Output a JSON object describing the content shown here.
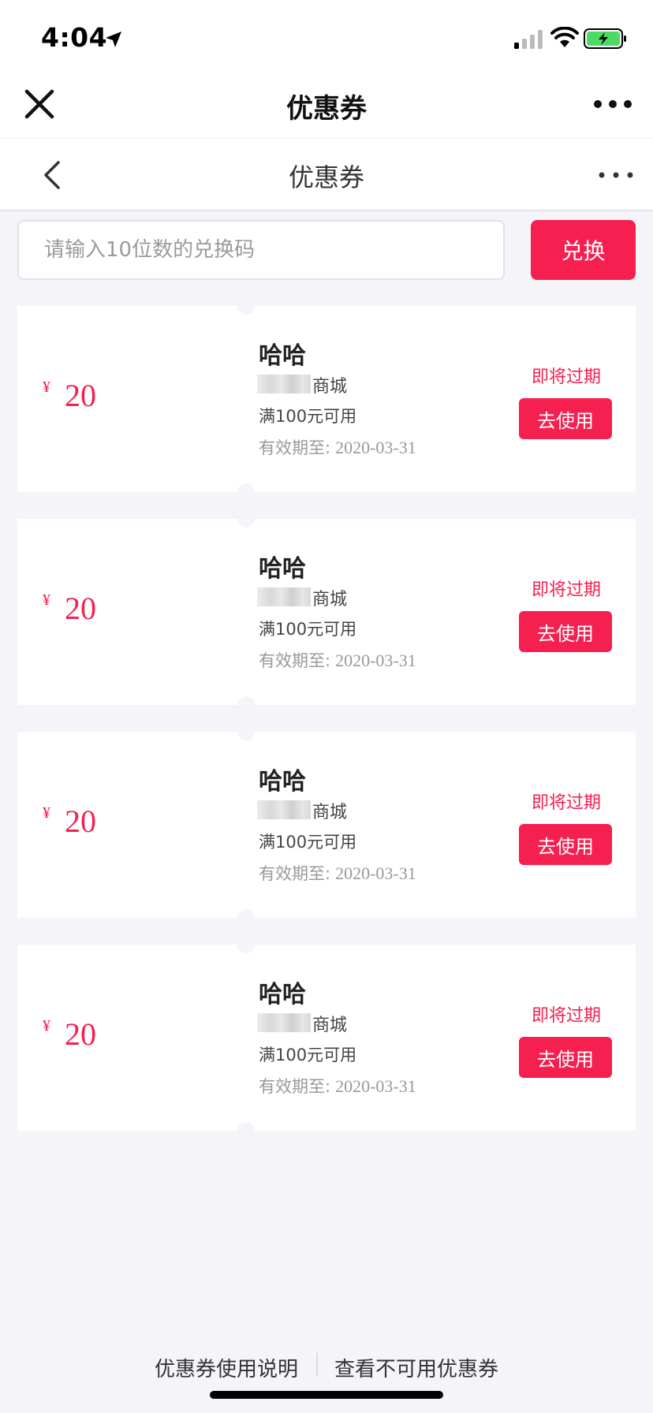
{
  "status_bar": {
    "time": "4:04"
  },
  "wechat_nav": {
    "title": "优惠券"
  },
  "page_header": {
    "title": "优惠券"
  },
  "redeem": {
    "placeholder": "请输入10位数的兑换码",
    "button_label": "兑换"
  },
  "coupons": [
    {
      "currency": "¥",
      "amount": "20",
      "name": "哈哈",
      "store": "商城",
      "condition": "满100元可用",
      "expiry_label": "有效期至:",
      "expiry_date": "2020-03-31",
      "badge": "即将过期",
      "action_label": "去使用"
    },
    {
      "currency": "¥",
      "amount": "20",
      "name": "哈哈",
      "store": "商城",
      "condition": "满100元可用",
      "expiry_label": "有效期至:",
      "expiry_date": "2020-03-31",
      "badge": "即将过期",
      "action_label": "去使用"
    },
    {
      "currency": "¥",
      "amount": "20",
      "name": "哈哈",
      "store": "商城",
      "condition": "满100元可用",
      "expiry_label": "有效期至:",
      "expiry_date": "2020-03-31",
      "badge": "即将过期",
      "action_label": "去使用"
    },
    {
      "currency": "¥",
      "amount": "20",
      "name": "哈哈",
      "store": "商城",
      "condition": "满100元可用",
      "expiry_label": "有效期至:",
      "expiry_date": "2020-03-31",
      "badge": "即将过期",
      "action_label": "去使用"
    }
  ],
  "footer": {
    "instructions_link": "优惠券使用说明",
    "unavailable_link": "查看不可用优惠券"
  },
  "colors": {
    "accent": "#f52050",
    "background": "#f4f4f9",
    "battery": "#4cd964"
  }
}
